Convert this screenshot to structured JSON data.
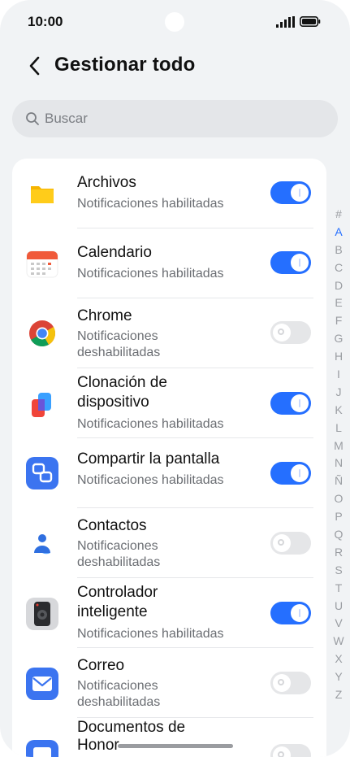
{
  "status_bar": {
    "time": "10:00"
  },
  "header": {
    "title": "Gestionar todo"
  },
  "search": {
    "placeholder": "Buscar"
  },
  "apps": [
    {
      "name_line1": "Archivos",
      "name_line2": "",
      "status_line1": "Notificaciones habilitadas",
      "status_line2": "",
      "enabled": true,
      "icon": "files-folder-icon"
    },
    {
      "name_line1": "Calendario",
      "name_line2": "",
      "status_line1": "Notificaciones habilitadas",
      "status_line2": "",
      "enabled": true,
      "icon": "calendar-icon"
    },
    {
      "name_line1": "Chrome",
      "name_line2": "",
      "status_line1": "Notificaciones",
      "status_line2": "deshabilitadas",
      "enabled": false,
      "icon": "chrome-icon"
    },
    {
      "name_line1": "Clonación de",
      "name_line2": "dispositivo",
      "status_line1": "Notificaciones habilitadas",
      "status_line2": "",
      "enabled": true,
      "icon": "device-clone-icon"
    },
    {
      "name_line1": "Compartir la pantalla",
      "name_line2": "",
      "status_line1": "Notificaciones habilitadas",
      "status_line2": "",
      "enabled": true,
      "icon": "screen-share-icon"
    },
    {
      "name_line1": "Contactos",
      "name_line2": "",
      "status_line1": "Notificaciones",
      "status_line2": "deshabilitadas",
      "enabled": false,
      "icon": "contacts-icon"
    },
    {
      "name_line1": "Controlador",
      "name_line2": "inteligente",
      "status_line1": "Notificaciones habilitadas",
      "status_line2": "",
      "enabled": true,
      "icon": "smart-remote-icon"
    },
    {
      "name_line1": "Correo",
      "name_line2": "",
      "status_line1": "Notificaciones",
      "status_line2": "deshabilitadas",
      "enabled": false,
      "icon": "mail-icon"
    },
    {
      "name_line1": "Documentos de",
      "name_line2": "Honor",
      "status_line1": "",
      "status_line2": "",
      "enabled": false,
      "icon": "documents-icon"
    }
  ],
  "alphabet_index": [
    "#",
    "A",
    "B",
    "C",
    "D",
    "E",
    "F",
    "G",
    "H",
    "I",
    "J",
    "K",
    "L",
    "M",
    "N",
    "Ñ",
    "O",
    "P",
    "Q",
    "R",
    "S",
    "T",
    "U",
    "V",
    "W",
    "X",
    "Y",
    "Z"
  ],
  "alphabet_active": "A",
  "colors": {
    "accent": "#256fff",
    "background": "#f1f3f5",
    "card": "#ffffff"
  }
}
